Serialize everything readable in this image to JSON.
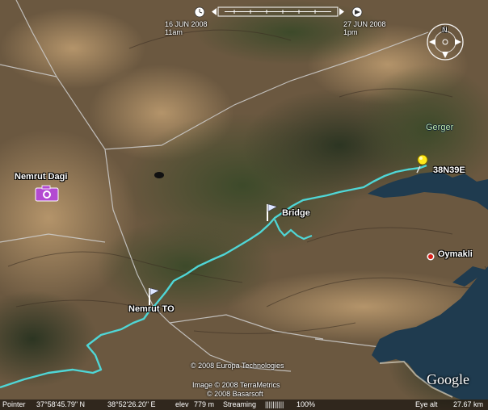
{
  "time_slider": {
    "start_date": "16 JUN 2008",
    "start_time": "11am",
    "end_date": "27 JUN 2008",
    "end_time": "1pm"
  },
  "compass": {
    "north_label": "N"
  },
  "places": {
    "nemrut_dagi": "Nemrut Dagi",
    "nemrut_to": "Nemrut TO",
    "bridge": "Bridge",
    "gerger": "Gerger",
    "coord_marker": "38N39E",
    "oymakli": "Oymakli"
  },
  "credits": {
    "line1": "© 2008 Europa Technologies",
    "line2": "Image © 2008 TerraMetrics",
    "line3": "© 2008 Basarsoft"
  },
  "logo": "Google",
  "status": {
    "pointer_label": "Pointer",
    "lat": "37°58'45.79\" N",
    "lon": "38°52'26.20\" E",
    "elev_label": "elev",
    "elev": "779 m",
    "streaming_label": "Streaming",
    "streaming_bars": "||||||||||",
    "streaming_pct": "100%",
    "eye_label": "Eye alt",
    "eye_alt": "27.67 km"
  },
  "colors": {
    "track": "#4fd6d6",
    "water": "#1e3a4e",
    "road": "#c9c9c9",
    "pin": "#ffe81a"
  },
  "icons": [
    "camera-icon",
    "flag-icon",
    "pushpin-icon",
    "red-dot-icon",
    "compass-icon",
    "clock-icon"
  ]
}
